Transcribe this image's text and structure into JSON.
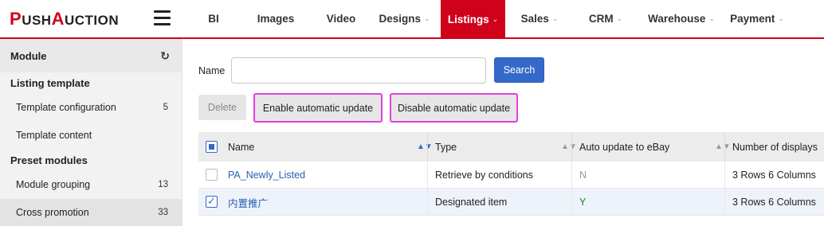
{
  "brand": {
    "logo_p": "P",
    "logo_ush": "USH",
    "logo_a": "A",
    "logo_uction": "UCTION"
  },
  "colors": {
    "brand_red": "#d0021b",
    "primary_blue": "#3569c9",
    "highlight_magenta": "#e040e0"
  },
  "nav": {
    "items": [
      {
        "label": "BI",
        "has_dropdown": false,
        "active": false
      },
      {
        "label": "Images",
        "has_dropdown": false,
        "active": false
      },
      {
        "label": "Video",
        "has_dropdown": false,
        "active": false
      },
      {
        "label": "Designs",
        "has_dropdown": true,
        "active": false
      },
      {
        "label": "Listings",
        "has_dropdown": true,
        "active": true
      },
      {
        "label": "Sales",
        "has_dropdown": true,
        "active": false
      },
      {
        "label": "CRM",
        "has_dropdown": true,
        "active": false
      },
      {
        "label": "Warehouse",
        "has_dropdown": true,
        "active": false
      },
      {
        "label": "Payment",
        "has_dropdown": true,
        "active": false
      }
    ],
    "chevron": "⌄"
  },
  "sidebar": {
    "title": "Module",
    "refresh_icon": "refresh-icon",
    "sections": [
      {
        "label": "Listing template"
      },
      {
        "label": "Preset modules"
      }
    ],
    "items": [
      {
        "label": "Template configuration",
        "count": "5"
      },
      {
        "label": "Template content",
        "count": ""
      },
      {
        "label": "Module grouping",
        "count": "13"
      },
      {
        "label": "Cross promotion",
        "count": "33"
      }
    ]
  },
  "search": {
    "label": "Name",
    "value": "",
    "placeholder": "",
    "button": "Search"
  },
  "actions": {
    "delete": "Delete",
    "enable": "Enable automatic update",
    "disable": "Disable automatic update"
  },
  "table": {
    "headers": [
      "Name",
      "Type",
      "Auto update to eBay",
      "Number of displays"
    ],
    "rows": [
      {
        "name": "PA_Newly_Listed",
        "type": "Retrieve by conditions",
        "auto_update": "N",
        "displays": "3 Rows 6 Columns",
        "checked": false
      },
      {
        "name": "内置推广",
        "type": "Designated item",
        "auto_update": "Y",
        "displays": "3 Rows 6 Columns",
        "checked": true
      }
    ]
  }
}
